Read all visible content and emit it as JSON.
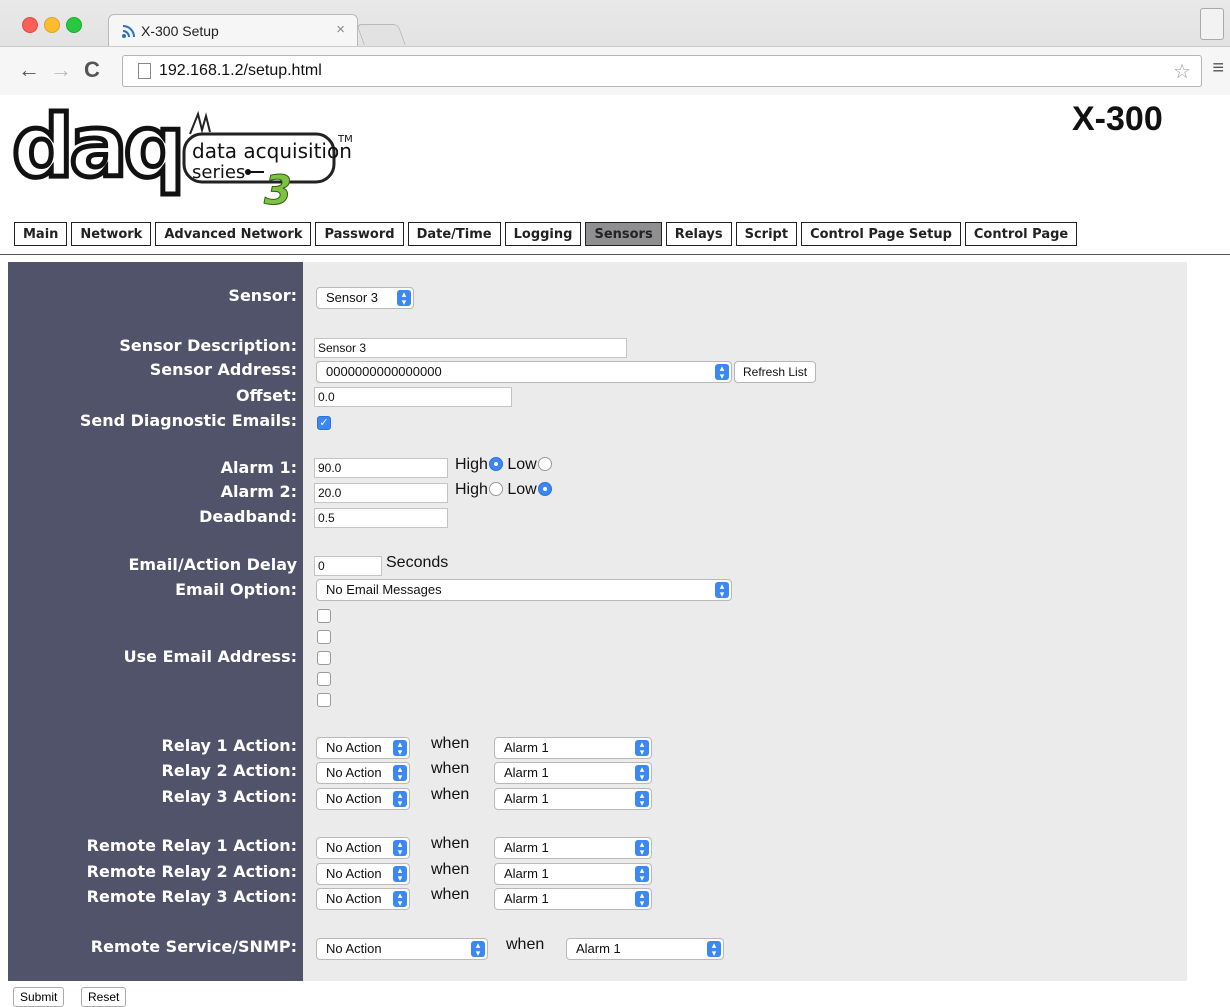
{
  "browser": {
    "tab_title": "X-300 Setup",
    "tab_close": "×",
    "url": "192.168.1.2/setup.html",
    "back": "←",
    "forward": "→",
    "reload": "C",
    "star": "☆",
    "menu": "≡"
  },
  "header": {
    "logo_text": "daq",
    "logo_sub1": "data acquisition",
    "logo_sub2": "series",
    "logo_tm": "TM",
    "logo_num": "3",
    "model": "X-300"
  },
  "nav": {
    "tabs": [
      "Main",
      "Network",
      "Advanced Network",
      "Password",
      "Date/Time",
      "Logging",
      "Sensors",
      "Relays",
      "Script",
      "Control Page Setup",
      "Control Page"
    ],
    "active": "Sensors"
  },
  "form": {
    "labels": {
      "sensor": "Sensor:",
      "description": "Sensor Description:",
      "address": "Sensor Address:",
      "offset": "Offset:",
      "diag": "Send Diagnostic Emails:",
      "alarm1": "Alarm 1:",
      "alarm2": "Alarm 2:",
      "deadband": "Deadband:",
      "delay": "Email/Action Delay",
      "email_option": "Email Option:",
      "use_email": "Use Email Address:",
      "relay1": "Relay 1 Action:",
      "relay2": "Relay 2 Action:",
      "relay3": "Relay 3 Action:",
      "rrelay1": "Remote Relay 1 Action:",
      "rrelay2": "Remote Relay 2 Action:",
      "rrelay3": "Remote Relay 3 Action:",
      "snmp": "Remote Service/SNMP:"
    },
    "sensor_select": "Sensor 3",
    "description_value": "Sensor 3",
    "address_value": "0000000000000000",
    "refresh_label": "Refresh List",
    "offset_value": "0.0",
    "diag_checked": true,
    "alarm1_value": "90.0",
    "alarm1_mode": "High",
    "alarm2_value": "20.0",
    "alarm2_mode": "Low",
    "high_label": "High",
    "low_label": "Low",
    "deadband_value": "0.5",
    "delay_value": "0",
    "seconds_label": "Seconds",
    "email_option_value": "No Email Messages",
    "when_label": "when",
    "action_value": "No Action",
    "alarm_value": "Alarm 1"
  },
  "buttons": {
    "submit": "Submit",
    "reset": "Reset"
  },
  "colors": {
    "label_column": "#51536a",
    "form_background": "#ebebec",
    "active_tab": "#8f8f92",
    "select_accent": "#3b88f5"
  }
}
